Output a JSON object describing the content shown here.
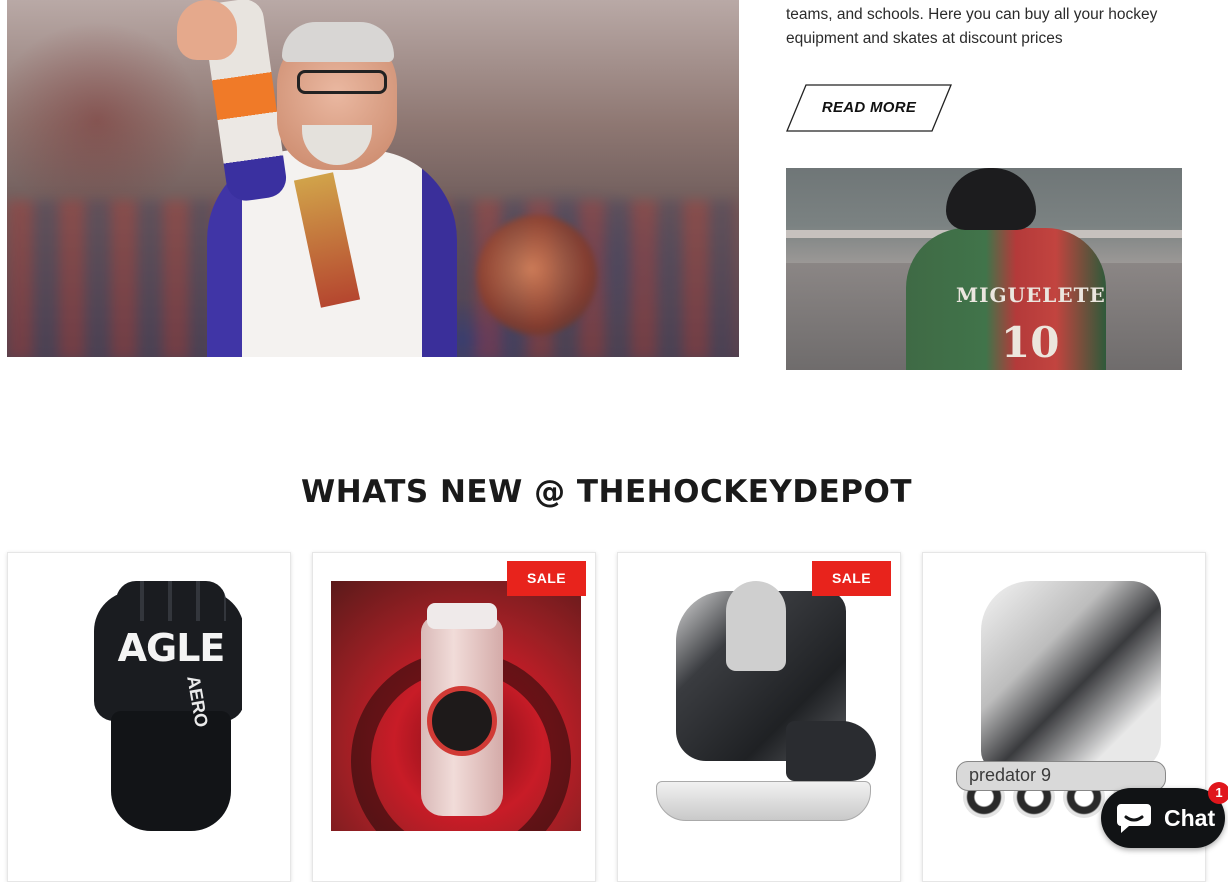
{
  "about": {
    "text": "teams, and schools. Here you can buy all your hockey equipment and skates at discount prices",
    "read_more_label": "READ MORE"
  },
  "player_image": {
    "jersey_name": "MIGUELETE",
    "jersey_number": "10"
  },
  "section_title": "WHATS NEW @ THEHOCKEYDEPOT",
  "products": [
    {
      "image": "hockey-glove",
      "sale_label": "",
      "brand_text": "AGLE",
      "model_text": "AERO"
    },
    {
      "image": "wax-bottle",
      "sale_label": "SALE"
    },
    {
      "image": "ice-skate",
      "sale_label": "SALE"
    },
    {
      "image": "inline-skate",
      "sale_label": "",
      "frame_text": "predator 9"
    }
  ],
  "chat": {
    "label": "Chat",
    "badge_count": "1"
  },
  "colors": {
    "sale": "#e8231c",
    "chat_bg": "#111315",
    "badge": "#e0161c"
  }
}
